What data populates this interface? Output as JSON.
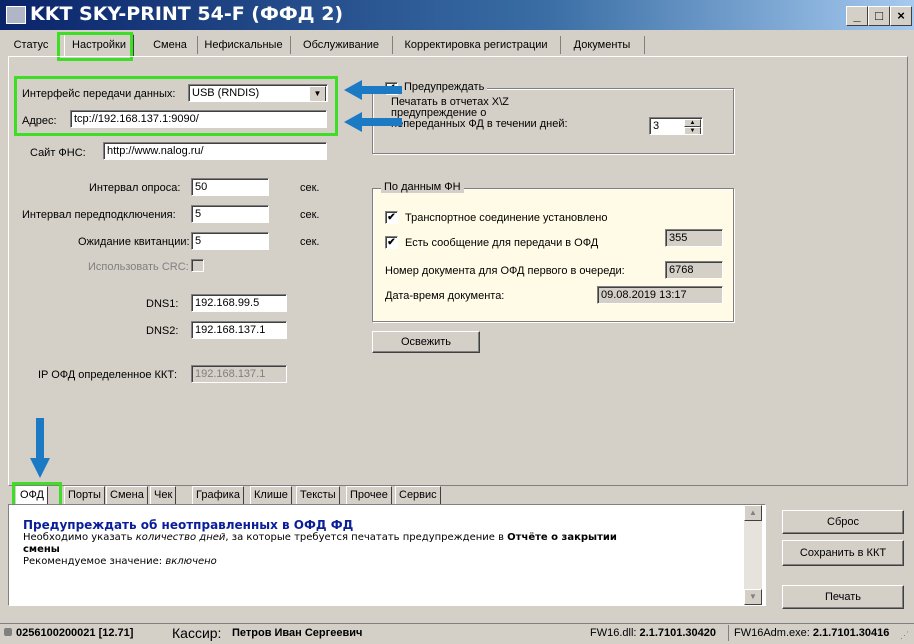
{
  "window": {
    "title": "KKT SKY-PRINT 54-F (ФФД 2)",
    "buttons": [
      "_",
      "□",
      "×"
    ]
  },
  "top_tabs": [
    "Статус",
    "Настройки",
    "Смена",
    "Нефискальные",
    "Обслуживание",
    "Корректировка регистрации",
    "Документы"
  ],
  "settings": {
    "interface_label": "Интерфейс передачи данных:",
    "interface_value": "USB (RNDIS)",
    "address_label": "Адрес:",
    "address_value": "tcp://192.168.137.1:9090/",
    "fns_site_label": "Сайт ФНС:",
    "fns_site_value": "http://www.nalog.ru/",
    "poll_interval_label": "Интервал опроса:",
    "poll_interval_value": "50",
    "reconnect_label": "Интервал передподключения:",
    "reconnect_value": "5",
    "receipt_wait_label": "Ожидание квитанции:",
    "receipt_wait_value": "5",
    "sec": "сек.",
    "use_crc_label": "Использовать CRC:",
    "dns1_label": "DNS1:",
    "dns1_value": "192.168.99.5",
    "dns2_label": "DNS2:",
    "dns2_value": "192.168.137.1",
    "ofd_ip_label": "IP ОФД определенное ККТ:",
    "ofd_ip_value": "192.168.137.1"
  },
  "warn_group": {
    "title": "Предупреждать",
    "text_line1": "Печатать в отчетах Х\\Z",
    "text_line2": "предупреждение о",
    "text_line3": "непереданных ФД в течении дней:",
    "days_value": "3"
  },
  "fn_group": {
    "title": "По данным ФН",
    "transport_label": "Транспортное соединение установлено",
    "message_label": "Есть сообщение для передачи в ОФД",
    "message_value": "355",
    "doc_num_label": "Номер документа для ОФД первого в очереди:",
    "doc_num_value": "6768",
    "doc_date_label": "Дата-время документа:",
    "doc_date_value": "09.08.2019 13:17"
  },
  "refresh_button": "Освежить",
  "bottom_tabs": [
    "ОФД",
    "Порты",
    "Смена",
    "Чек",
    "Графика",
    "Клише",
    "Тексты",
    "Прочее",
    "Сервис"
  ],
  "help": {
    "title": "Предупреждать об неотправленных в ОФД ФД",
    "line1_a": "Необходимо указать ",
    "line1_b": "количество дней",
    "line1_c": ", за которые требуется печатать предупреждение в ",
    "line1_d": "Отчёте о закрытии",
    "line2": "смены",
    "line3_a": "Рекомендуемое значение: ",
    "line3_b": "включено"
  },
  "side_buttons": [
    "Сброс",
    "Сохранить в ККТ",
    "Печать"
  ],
  "status": {
    "device": "0256100200021 [12.71]",
    "cashier_label": "Кассир:",
    "cashier_name": "Петров Иван Сергеевич",
    "fw_dll_label": "FW16.dll:",
    "fw_dll_version": "2.1.7101.30420",
    "fw_exe_label": "FW16Adm.exe:",
    "fw_exe_version": "2.1.7101.30416"
  },
  "colors": {
    "highlight": "#3ede27",
    "arrow": "#1c79c4",
    "title_bar": "#0a246a",
    "help_title": "#0a1e9a",
    "fn_group_bg": "#fffbe6"
  }
}
